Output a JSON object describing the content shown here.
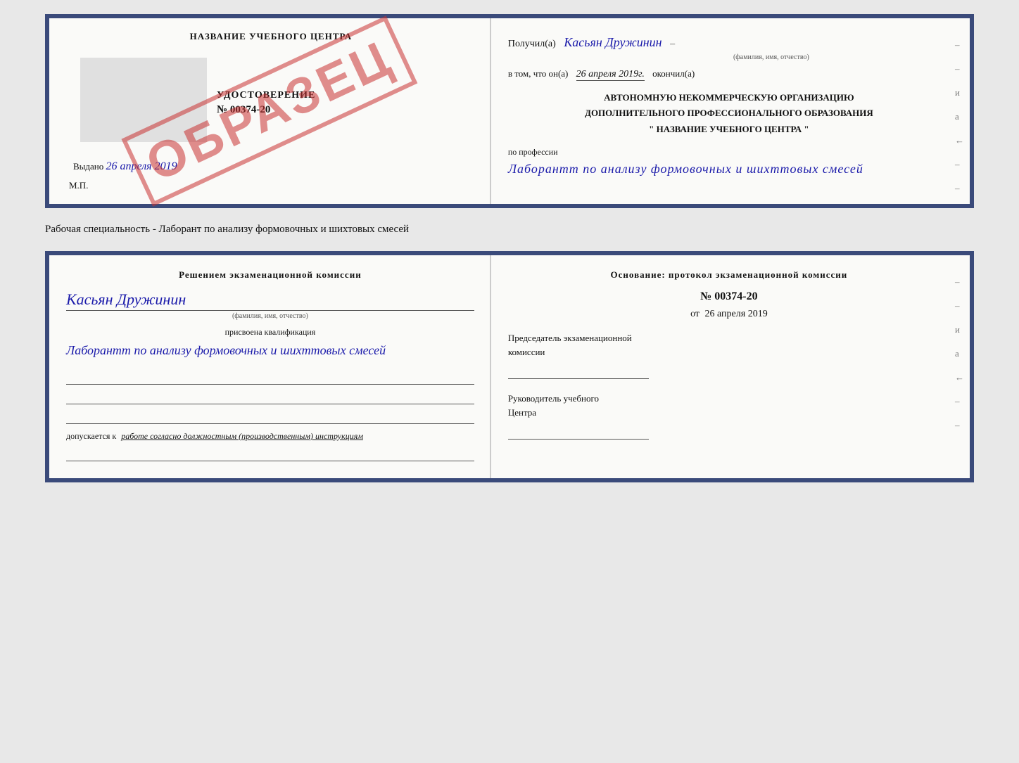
{
  "top_doc": {
    "left": {
      "center_name": "НАЗВАНИЕ УЧЕБНОГО ЦЕНТРА",
      "udostoverenie_label": "УДОСТОВЕРЕНИЕ",
      "udostoverenie_number": "№ 00374-20",
      "vydano_prefix": "Выдано",
      "vydano_date": "26 апреля 2019",
      "mp": "М.П.",
      "stamp_text": "ОБРАЗЕЦ"
    },
    "right": {
      "poluchil_prefix": "Получил(а)",
      "poluchil_name": "Касьян Дружинин",
      "poluchil_sub": "(фамилия, имя, отчество)",
      "vtom_prefix": "в том, что он(а)",
      "vtom_date": "26 апреля 2019г.",
      "okonchil": "окончил(а)",
      "avtonom_line1": "АВТОНОМНУЮ НЕКОММЕРЧЕСКУЮ ОРГАНИЗАЦИЮ",
      "avtonom_line2": "ДОПОЛНИТЕЛЬНОГО ПРОФЕССИОНАЛЬНОГО ОБРАЗОВАНИЯ",
      "avtonom_line3": "\"   НАЗВАНИЕ УЧЕБНОГО ЦЕНТРА   \"",
      "po_professii": "по профессии",
      "professiya": "Лаборантт по анализу формовочных и шихттовых смесей",
      "side_chars": [
        "–",
        "–",
        "и",
        "а",
        "←",
        "–",
        "–"
      ]
    }
  },
  "specialty_text": "Рабочая специальность - Лаборант по анализу формовочных и шихтовых смесей",
  "bottom_doc": {
    "left": {
      "resheniem_title": "Решением экзаменационной комиссии",
      "name": "Касьян Дружинин",
      "familiya_sub": "(фамилия, имя, отчество)",
      "prisvoena": "присвоена квалификация",
      "kvalif": "Лаборантт по анализу формовочных и шихттовых смесей",
      "dopusk_prefix": "допускается к",
      "dopusk_italic": "работе согласно должностным (производственным) инструкциям"
    },
    "right": {
      "osnovanie": "Основание: протокол экзаменационной комиссии",
      "protocol_number": "№ 00374-20",
      "ot_prefix": "от",
      "ot_date": "26 апреля 2019",
      "predsedatel_line1": "Председатель экзаменационной",
      "predsedatel_line2": "комиссии",
      "rukovoditel_line1": "Руководитель учебного",
      "rukovoditel_line2": "Центра",
      "side_chars": [
        "–",
        "–",
        "и",
        "а",
        "←",
        "–",
        "–"
      ]
    }
  }
}
